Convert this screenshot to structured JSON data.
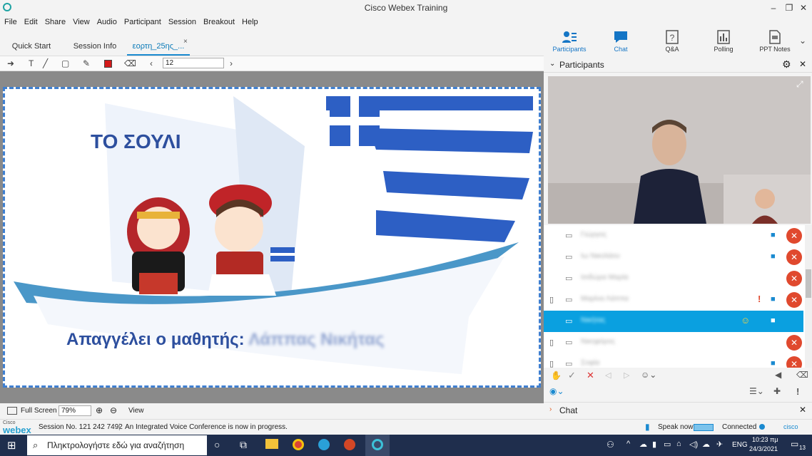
{
  "window": {
    "title": "Cisco Webex Training",
    "min": "–",
    "max": "❐",
    "close": "✕"
  },
  "menu": [
    "File",
    "Edit",
    "Share",
    "View",
    "Audio",
    "Participant",
    "Session",
    "Breakout",
    "Help"
  ],
  "tabs": [
    {
      "label": "Quick Start",
      "active": false
    },
    {
      "label": "Session Info",
      "active": false
    },
    {
      "label": "εορτη_25ης_...",
      "active": true
    }
  ],
  "tab_close": "×",
  "right_toolbar": [
    {
      "label": "Participants",
      "icon": "participants-icon",
      "active": true
    },
    {
      "label": "Chat",
      "icon": "chat-icon",
      "active": true
    },
    {
      "label": "Q&A",
      "icon": "qa-icon",
      "active": false
    },
    {
      "label": "Polling",
      "icon": "polling-icon",
      "active": false
    },
    {
      "label": "PPT Notes",
      "icon": "ppt-notes-icon",
      "active": false
    }
  ],
  "annotation": {
    "font_size": "12",
    "text_tool": "T"
  },
  "slide": {
    "title": "ΤΟ ΣΟΥΛΙ",
    "recites_label": "Απαγγέλει ο μαθητής:",
    "student_name": "Λάππας Νικήτας"
  },
  "content_status": {
    "full_screen": "Full Screen",
    "zoom": "79%",
    "view": "View"
  },
  "participants_panel": {
    "title": "Participants",
    "rows": [
      {
        "name": "Γιώργος",
        "has_video": true,
        "muted": true,
        "phone": false,
        "alert": false,
        "selected": false
      },
      {
        "name": "Ιω Νικολάου",
        "has_video": true,
        "muted": true,
        "phone": false,
        "alert": false,
        "selected": false
      },
      {
        "name": "Ισιδώρα Μαρία",
        "has_video": false,
        "muted": true,
        "phone": false,
        "alert": false,
        "selected": false
      },
      {
        "name": "Μαρίνα Λάππα",
        "has_video": true,
        "muted": true,
        "phone": true,
        "alert": true,
        "selected": false
      },
      {
        "name": "Νικήτας",
        "has_video": true,
        "muted": false,
        "phone": false,
        "alert": false,
        "selected": true
      },
      {
        "name": "Νικηφόρος",
        "has_video": false,
        "muted": true,
        "phone": true,
        "alert": false,
        "selected": false
      },
      {
        "name": "Σοφία",
        "has_video": true,
        "muted": true,
        "phone": true,
        "alert": false,
        "selected": false
      }
    ]
  },
  "chat_panel": {
    "title": "Chat"
  },
  "statusbar": {
    "brand_small": "Cisco",
    "brand": "webex",
    "session": "Session No. 121 242 7492",
    "voice": "An Integrated Voice Conference is now in progress.",
    "speak_now": "Speak now",
    "connected": "Connected",
    "cisco": "cisco"
  },
  "taskbar": {
    "search_placeholder": "Πληκτρολογήστε εδώ για αναζήτηση",
    "lang": "ENG",
    "time": "10:23 πμ",
    "date": "24/3/2021",
    "notifications": "13"
  },
  "colors": {
    "accent": "#1a8ad0",
    "mute": "#e0492e",
    "selected_row": "#0aa0e0",
    "slide_text": "#2d4f9e"
  }
}
